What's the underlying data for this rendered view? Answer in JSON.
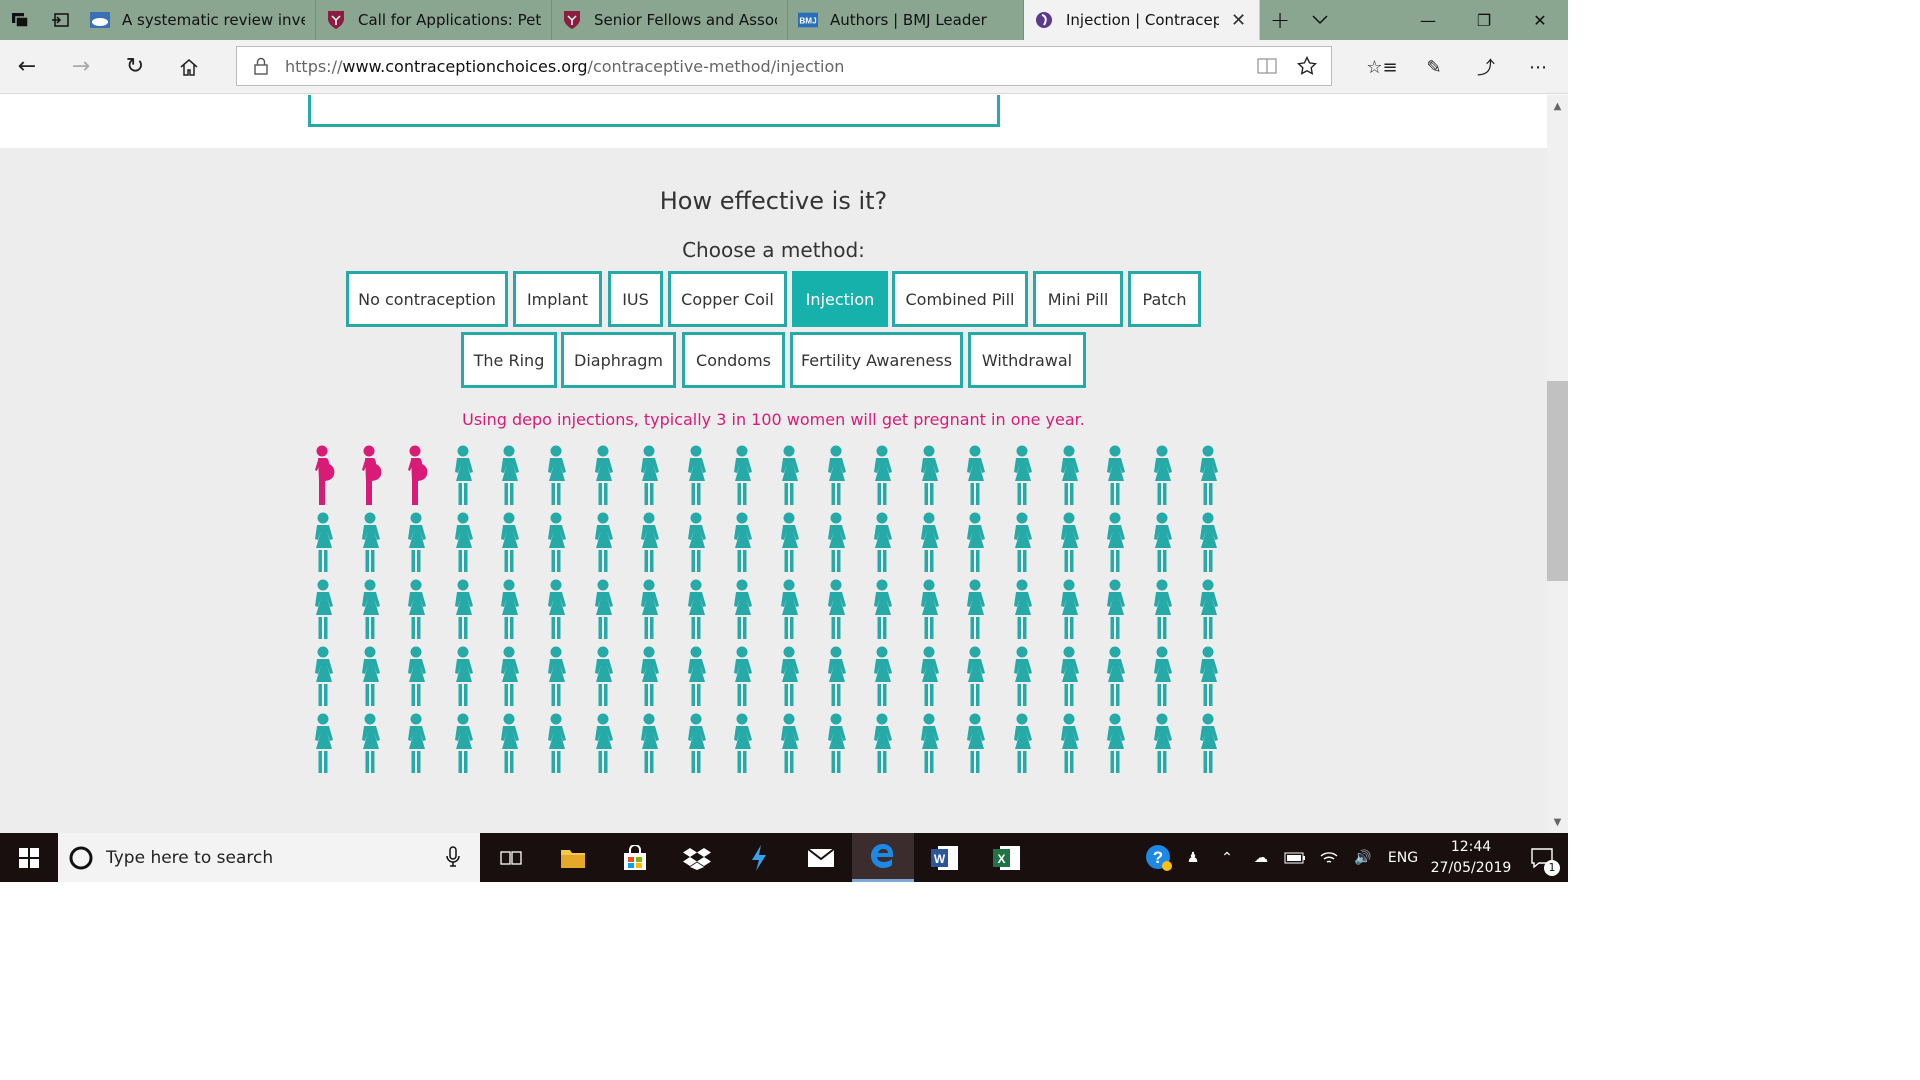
{
  "browser": {
    "tabs": [
      {
        "title": "A systematic review invest",
        "favicon": "cloud-image-icon"
      },
      {
        "title": "Call for Applications: Petri",
        "favicon": "shield-crest-icon"
      },
      {
        "title": "Senior Fellows and Associ",
        "favicon": "shield-crest-icon"
      },
      {
        "title": "Authors | BMJ Leader",
        "favicon": "bmj-logo-icon",
        "favicon_text": "BMJ"
      },
      {
        "title": "Injection | Contracepti",
        "favicon": "contraception-choices-icon",
        "active": true
      }
    ],
    "url_prefix": "https://",
    "url_domain": "www.contraceptionchoices.org",
    "url_path": "/contraceptive-method/injection"
  },
  "page": {
    "heading": "How effective is it?",
    "subheading": "Choose a method:",
    "methods_row1": [
      "No contraception",
      "Implant",
      "IUS",
      "Copper Coil",
      "Injection",
      "Combined Pill",
      "Mini Pill",
      "Patch"
    ],
    "methods_row2": [
      "The Ring",
      "Diaphragm",
      "Condoms",
      "Fertility Awareness",
      "Withdrawal"
    ],
    "selected_method": "Injection",
    "statistic": "Using depo injections, typically 3 in 100 women will get pregnant in one year.",
    "pictogram": {
      "total": 100,
      "pregnant": 3,
      "columns": 20,
      "rows": 5
    },
    "colors": {
      "teal": "#26aaa8",
      "pink": "#d81b77",
      "selected": "#17b1ac"
    }
  },
  "taskbar": {
    "search_placeholder": "Type here to search",
    "language": "ENG",
    "time": "12:44",
    "date": "27/05/2019",
    "notification_count": "1"
  }
}
